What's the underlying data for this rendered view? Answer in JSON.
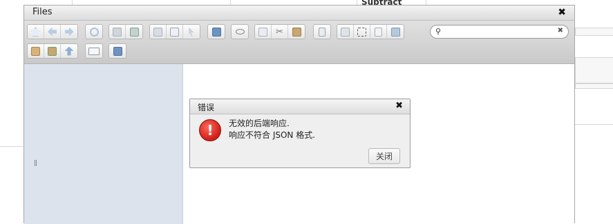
{
  "background": {
    "partial_text": "Subtract"
  },
  "window": {
    "title": "Files"
  },
  "toolbar": {
    "groups": [
      {
        "id": "g1",
        "icons": [
          "home-icon",
          "back-icon",
          "forward-icon"
        ]
      },
      {
        "id": "g2",
        "icons": [
          "reload-icon"
        ]
      },
      {
        "id": "g3",
        "icons": [
          "open-icon",
          "save-icon"
        ]
      },
      {
        "id": "g4",
        "icons": [
          "copy-doc-icon",
          "save-as-icon",
          "select-icon"
        ]
      },
      {
        "id": "g5",
        "icons": [
          "info-icon"
        ]
      },
      {
        "id": "g6",
        "icons": [
          "preview-icon"
        ]
      },
      {
        "id": "g7",
        "icons": [
          "copy-icon",
          "cut-icon",
          "paste-icon"
        ]
      },
      {
        "id": "g8",
        "icons": [
          "edit-icon"
        ]
      },
      {
        "id": "g9",
        "icons": [
          "duplicate-icon",
          "rename-icon",
          "new-file-icon",
          "resize-icon"
        ]
      },
      {
        "id": "g10",
        "icons": [
          "extract-icon",
          "archive-icon",
          "upload-icon"
        ]
      },
      {
        "id": "g11",
        "icons": [
          "view-icon"
        ]
      },
      {
        "id": "g12",
        "icons": [
          "help-icon"
        ]
      }
    ],
    "search": {
      "value": "",
      "placeholder": ""
    }
  },
  "dialog": {
    "title": "错误",
    "message_line1": "无效的后端响应.",
    "message_line2": "响应不符合 JSON 格式.",
    "close_label": "关闭"
  },
  "colors": {
    "sidebar_bg": "#dce3ec",
    "error_red": "#d2221b",
    "toolbar_bg": "#d4d4d4"
  }
}
